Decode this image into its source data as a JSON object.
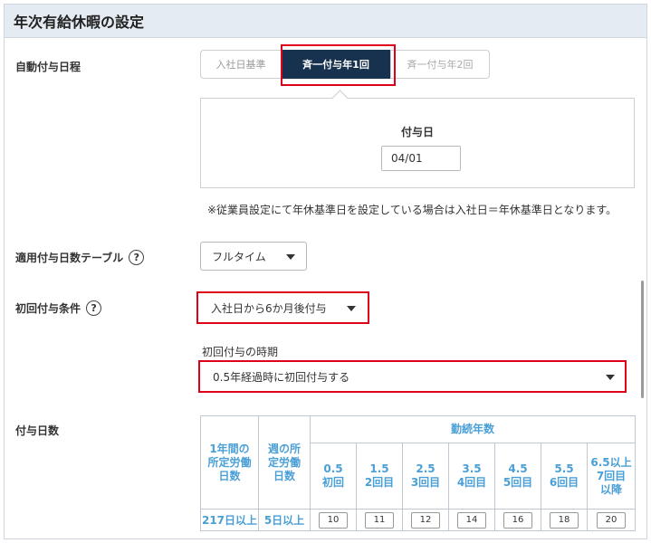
{
  "section_title": "年次有給休暇の設定",
  "auto_grant": {
    "label": "自動付与日程",
    "options": [
      "入社日基準",
      "斉一付与年1回",
      "斉一付与年2回"
    ],
    "selected": "斉一付与年1回"
  },
  "grant_date": {
    "label": "付与日",
    "value": "04/01"
  },
  "note": "※従業員設定にて年休基準日を設定している場合は入社日＝年休基準日となります。",
  "table_setting": {
    "label": "適用付与日数テーブル",
    "help_icon": "?",
    "value": "フルタイム"
  },
  "first_grant": {
    "label": "初回付与条件",
    "help_icon": "?",
    "value": "入社日から6か月後付与",
    "timing_label": "初回付与の時期",
    "timing_value": "0.5年経過時に初回付与する"
  },
  "grant_days": {
    "label": "付与日数",
    "col_annual": "1年間の所定労働日数",
    "col_weekly": "週の所定労働日数",
    "col_years": "勤続年数",
    "year_headers": [
      {
        "num": "0.5",
        "sub": "初回"
      },
      {
        "num": "1.5",
        "sub": "2回目"
      },
      {
        "num": "2.5",
        "sub": "3回目"
      },
      {
        "num": "3.5",
        "sub": "4回目"
      },
      {
        "num": "4.5",
        "sub": "5回目"
      },
      {
        "num": "5.5",
        "sub": "6回目"
      },
      {
        "num": "6.5以上",
        "sub": "7回目以降"
      }
    ],
    "rows": [
      {
        "annual": "217日以上",
        "weekly": "5日以上",
        "values": [
          "10",
          "11",
          "12",
          "14",
          "16",
          "18",
          "20"
        ]
      }
    ]
  },
  "colors": {
    "accent": "#17324f",
    "highlight": "#e0001a",
    "header_blue": "#4a9fd6"
  }
}
